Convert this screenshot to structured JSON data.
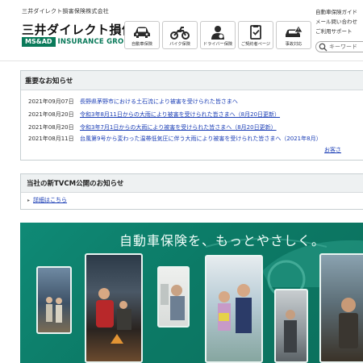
{
  "header": {
    "company_name": "三井ダイレクト損害保険株式会社",
    "logo_ja": "三井ダイレクト損保",
    "logo_msad": "MS&AD",
    "logo_group": "INSURANCE GROUP"
  },
  "nav": {
    "items": [
      {
        "label": "自動車保険",
        "icon": "car-icon"
      },
      {
        "label": "バイク保険",
        "icon": "motorcycle-icon"
      },
      {
        "label": "ドライバー保険",
        "icon": "driver-icon"
      },
      {
        "label": "ご契約者ページ",
        "icon": "contract-icon"
      },
      {
        "label": "事故対応",
        "icon": "accident-icon"
      }
    ]
  },
  "util_links": [
    "自動車保険ガイド",
    "メール問い合わせ",
    "ご利用サポート"
  ],
  "search": {
    "placeholder": "キーワード"
  },
  "notices": {
    "title": "重要なお知らせ",
    "items": [
      {
        "date": "2021年09月07日",
        "text": "長野県茅野市における土石流により被害を受けられた皆さまへ"
      },
      {
        "date": "2021年08月20日",
        "text": "令和3年8月11日からの大雨により被害を受けられた皆さまへ（8月20日更新）"
      },
      {
        "date": "2021年08月20日",
        "text": "令和3年7月1日からの大雨により被害を受けられた皆さまへ（8月20日更新）"
      },
      {
        "date": "2021年08月11日",
        "text": "台風第9号から変わった温帯低気圧に伴う大雨により被害を受けられた皆さまへ（2021年8月）"
      }
    ],
    "more": "お客さ"
  },
  "tvcm": {
    "title": "当社の新TVCM公開のお知らせ",
    "link": "詳細はこちら"
  },
  "banner": {
    "tagline": "自動車保険を、もっとやさしく。"
  },
  "colors": {
    "brand_green": "#0a7a5a",
    "link_blue": "#1a3db5",
    "banner_green": "#0f8a76"
  }
}
